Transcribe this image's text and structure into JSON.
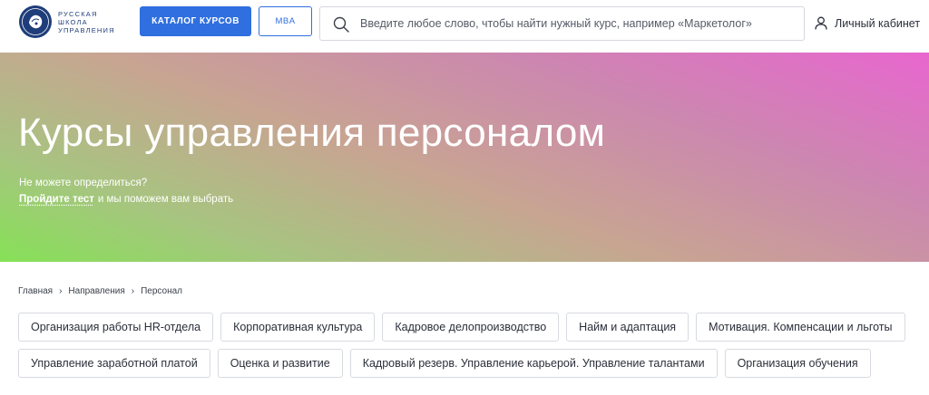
{
  "logo": {
    "lines": [
      "РУССКАЯ",
      "ШКОЛА",
      "УПРАВЛЕНИЯ"
    ]
  },
  "header": {
    "catalog_label": "КАТАЛОГ КУРСОВ",
    "mba_label": "MBA",
    "search_placeholder": "Введите любое слово, чтобы найти нужный курс, например «Маркетолог»",
    "cabinet_label": "Личный кабинет"
  },
  "hero": {
    "title": "Курсы управления персоналом",
    "subtitle": "Не можете определиться?",
    "test_link": "Пройдите тест",
    "test_suffix": "и мы поможем вам выбрать"
  },
  "breadcrumb": [
    "Главная",
    "Направления",
    "Персонал"
  ],
  "chips": {
    "row1": [
      "Организация работы HR-отдела",
      "Корпоративная культура",
      "Кадровое делопроизводство",
      "Найм и адаптация",
      "Мотивация. Компенсации и льготы"
    ],
    "row2": [
      "Управление заработной платой",
      "Оценка и развитие",
      "Кадровый резерв. Управление карьерой. Управление талантами",
      "Организация обучения"
    ]
  },
  "colors": {
    "accent": "#2f6fe0",
    "logo": "#1f3d7a",
    "hero_gradient": [
      "#e866cf",
      "#c8a492",
      "#86e157"
    ]
  }
}
